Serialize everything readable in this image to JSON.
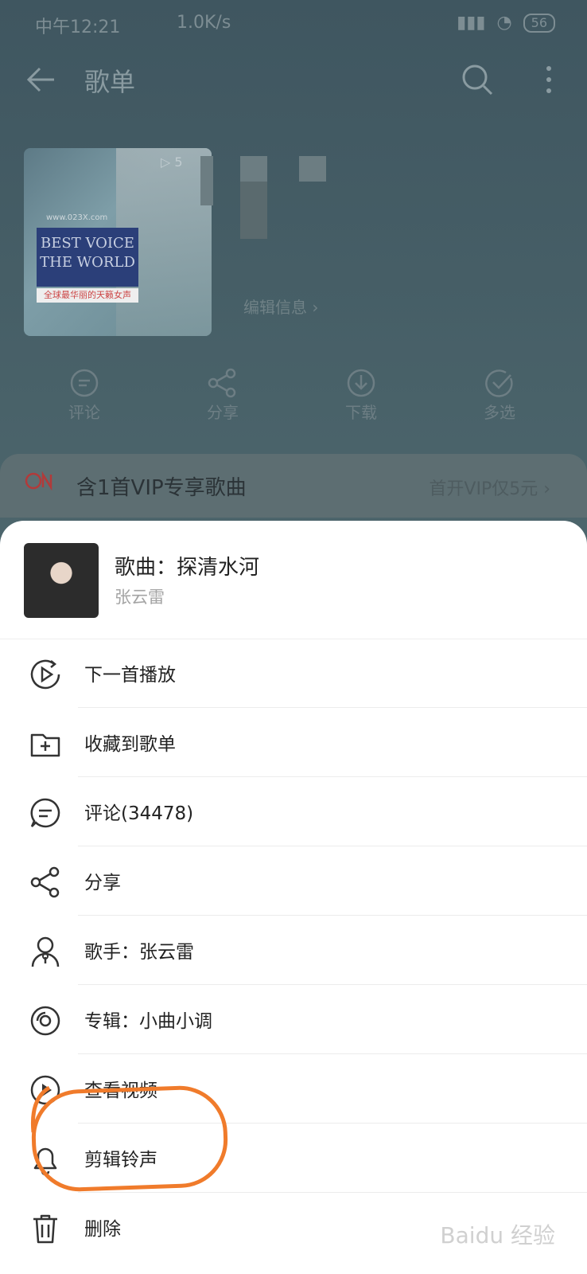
{
  "status": {
    "time": "中午12:21",
    "speed": "1.0K/s",
    "battery": "56"
  },
  "appbar": {
    "title": "歌单"
  },
  "playlist": {
    "play_count": "▷ 5",
    "edit_info": "编辑信息 ›",
    "cover_site": "www.023X.com",
    "cover_text": "BEST VOICE THE WORLD",
    "cover_sub": "全球最华丽的天籁女声"
  },
  "actions": [
    {
      "label": "评论",
      "icon": "comment-icon"
    },
    {
      "label": "分享",
      "icon": "share-icon"
    },
    {
      "label": "下载",
      "icon": "download-icon"
    },
    {
      "label": "多选",
      "icon": "multiselect-icon"
    }
  ],
  "vip": {
    "label": "含1首VIP专享歌曲",
    "cta": "首开VIP仅5元 ›"
  },
  "song": {
    "title": "歌曲：探清水河",
    "artist": "张云雷"
  },
  "menu": [
    {
      "label": "下一首播放",
      "icon": "play-next-icon"
    },
    {
      "label": "收藏到歌单",
      "icon": "add-to-playlist-icon"
    },
    {
      "label": "评论(34478)",
      "icon": "comment-icon"
    },
    {
      "label": "分享",
      "icon": "share-icon"
    },
    {
      "label": "歌手：张云雷",
      "icon": "singer-icon"
    },
    {
      "label": "专辑：小曲小调",
      "icon": "album-icon"
    },
    {
      "label": "查看视频",
      "icon": "video-icon"
    },
    {
      "label": "剪辑铃声",
      "icon": "ringtone-icon"
    },
    {
      "label": "删除",
      "icon": "trash-icon"
    }
  ],
  "colors": {
    "highlight": "#f07b2b",
    "accent": "#b23a3a"
  }
}
